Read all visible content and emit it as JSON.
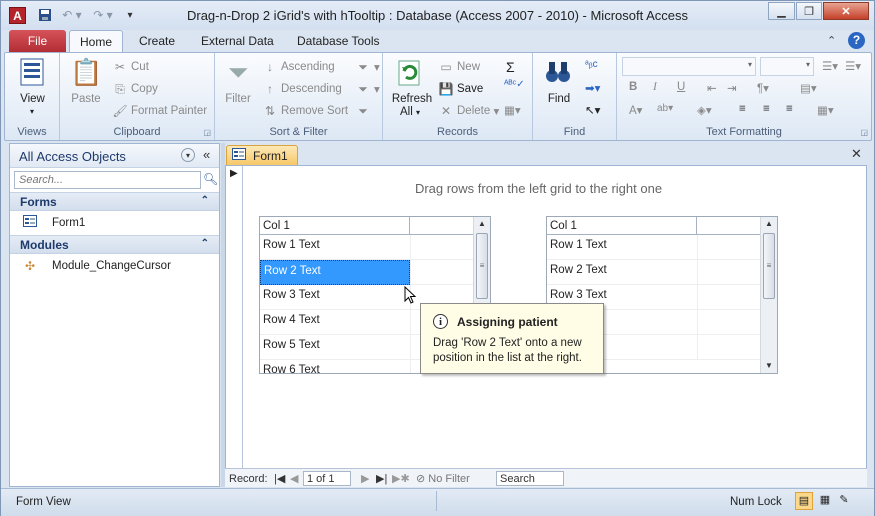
{
  "window": {
    "title": "Drag-n-Drop 2 iGrid's with hTooltip : Database (Access 2007 - 2010)  -  Microsoft Access",
    "app_icon_letter": "A"
  },
  "tabs": {
    "file": "File",
    "items": [
      "Home",
      "Create",
      "External Data",
      "Database Tools"
    ]
  },
  "ribbon": {
    "views": {
      "label": "Views",
      "view": "View"
    },
    "clipboard": {
      "label": "Clipboard",
      "paste": "Paste",
      "cut": "Cut",
      "copy": "Copy",
      "format_painter": "Format Painter"
    },
    "sort_filter": {
      "label": "Sort & Filter",
      "filter": "Filter",
      "ascending": "Ascending",
      "descending": "Descending",
      "remove_sort": "Remove Sort"
    },
    "records": {
      "label": "Records",
      "refresh": "Refresh",
      "all": "All",
      "new": "New",
      "save": "Save",
      "delete": "Delete"
    },
    "find": {
      "label": "Find",
      "find": "Find"
    },
    "text_formatting": {
      "label": "Text Formatting",
      "bold": "B",
      "italic": "I",
      "underline": "U"
    }
  },
  "nav_pane": {
    "title": "All Access Objects",
    "search_placeholder": "Search...",
    "sections": [
      {
        "name": "Forms",
        "items": [
          "Form1"
        ]
      },
      {
        "name": "Modules",
        "items": [
          "Module_ChangeCursor"
        ]
      }
    ]
  },
  "document": {
    "tab_label": "Form1",
    "caption": "Drag rows from the left grid to the right one",
    "left_grid": {
      "column": "Col 1",
      "rows": [
        "Row 1 Text",
        "Row 2 Text",
        "Row 3 Text",
        "Row 4 Text",
        "Row 5 Text",
        "Row 6 Text"
      ],
      "selected_row": "Row 2 Text"
    },
    "right_grid": {
      "column": "Col 1",
      "rows": [
        "Row 1 Text",
        "Row 2 Text",
        "Row 3 Text"
      ]
    },
    "tooltip": {
      "title": "Assigning patient",
      "body": "Drag 'Row 2 Text' onto a new position in the list at the right."
    }
  },
  "record_nav": {
    "label": "Record:",
    "position": "1 of 1",
    "filter": "No Filter",
    "search": "Search"
  },
  "status_bar": {
    "left": "Form View",
    "right": "Num Lock"
  },
  "colors": {
    "file_tab": "#b12b33",
    "selection": "#3399ff",
    "doc_tab": "#f7c767",
    "tooltip_bg": "#fffde6"
  }
}
